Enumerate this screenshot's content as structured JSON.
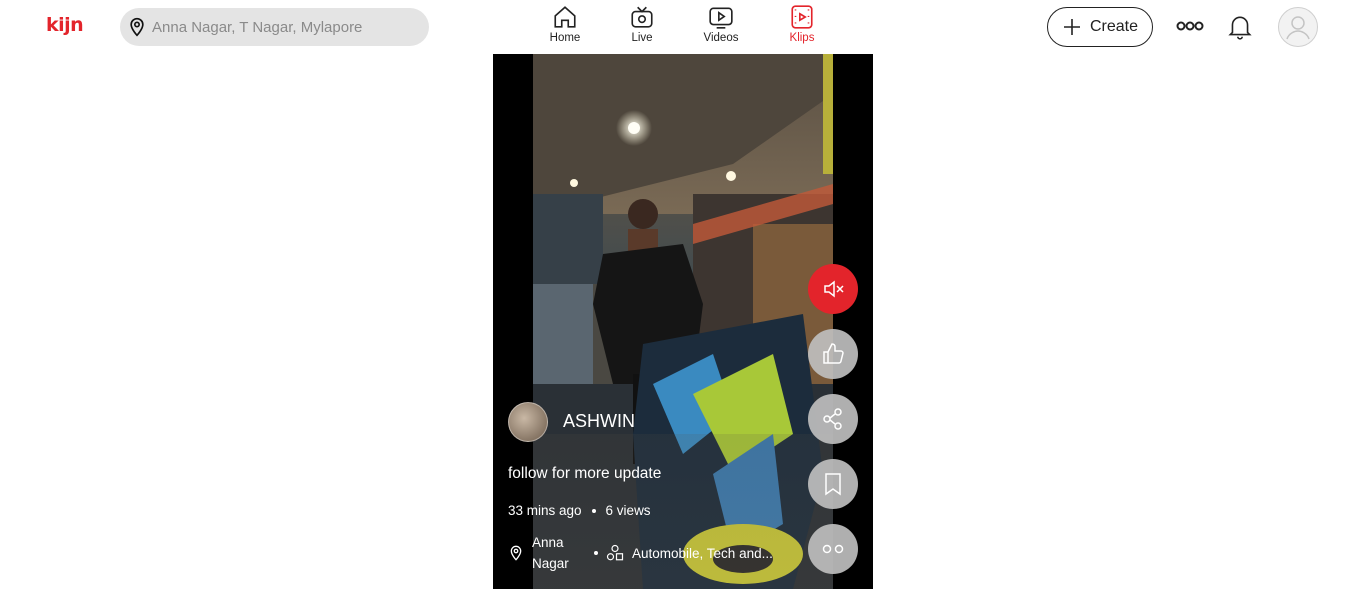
{
  "header": {
    "logo": "kijn",
    "search_placeholder": "Anna Nagar, T Nagar, Mylapore",
    "nav": [
      {
        "label": "Home",
        "icon": "home-icon"
      },
      {
        "label": "Live",
        "icon": "live-tv-icon"
      },
      {
        "label": "Videos",
        "icon": "video-play-icon"
      },
      {
        "label": "Klips",
        "icon": "klips-icon",
        "active": true
      }
    ],
    "create_label": "Create",
    "icons": [
      "more-icon",
      "bell-icon",
      "profile-avatar-icon"
    ]
  },
  "klip": {
    "author": "ASHWIN",
    "caption": "follow for more update",
    "time_ago": "33 mins ago",
    "views": "6 views",
    "location": "Anna Nagar",
    "category": "Automobile, Tech and...",
    "actions": [
      "mute-icon",
      "like-icon",
      "share-icon",
      "bookmark-icon",
      "more-options-icon"
    ]
  },
  "colors": {
    "accent": "#e3242b",
    "search_bg": "#e4e4e4",
    "action_bg": "#bebebe"
  }
}
